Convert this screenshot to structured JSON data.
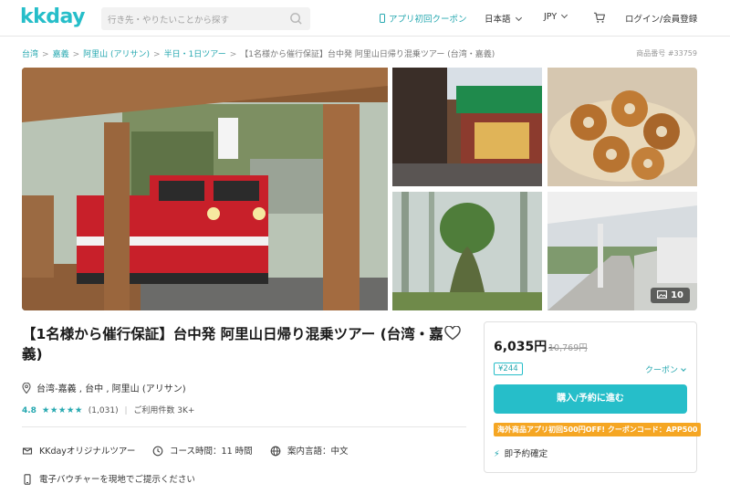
{
  "header": {
    "logo": "kkday",
    "search_placeholder": "行き先・やりたいことから探す",
    "app_coupon": "アプリ初回クーポン",
    "language": "日本語",
    "currency": "JPY",
    "login": "ログイン/会員登録",
    "brand_color": "#26bec9"
  },
  "breadcrumb": {
    "items": [
      "台湾",
      "嘉義",
      "阿里山 (アリサン)",
      "半日・1日ツアー"
    ],
    "current": "【1名様から催行保証】台中発 阿里山日帰り混乗ツアー (台湾・嘉義)",
    "separator": ">"
  },
  "product_number": "商品番号 #33759",
  "gallery": {
    "photo_count": "10"
  },
  "product": {
    "title": "【1名様から催行保証】台中発 阿里山日帰り混乗ツアー (台湾・嘉義)",
    "location": "台湾-嘉義 , 台中 , 阿里山 (アリサン)",
    "rating": "4.8",
    "stars": "★★★★★",
    "review_count": "(1,031)",
    "rating_sep": "|",
    "usage": "ご利用件数 3K+"
  },
  "features": {
    "operator": "KKdayオリジナルツアー",
    "duration": "コース時間：11 時間",
    "guide_language": "案内言語：中文",
    "voucher": "電子バウチャーを現地でご提示ください"
  },
  "booking": {
    "price": "6,035円",
    "price_suffix": "~",
    "original_price": "10,769円",
    "points": "¥244",
    "coupon_label": "クーポン",
    "book_button": "購入/予約に進む",
    "promo": "海外商品アプリ初回500円OFF! クーポンコード：APP500",
    "instant_confirm": "即予約確定",
    "promo_color": "#f5a623"
  }
}
